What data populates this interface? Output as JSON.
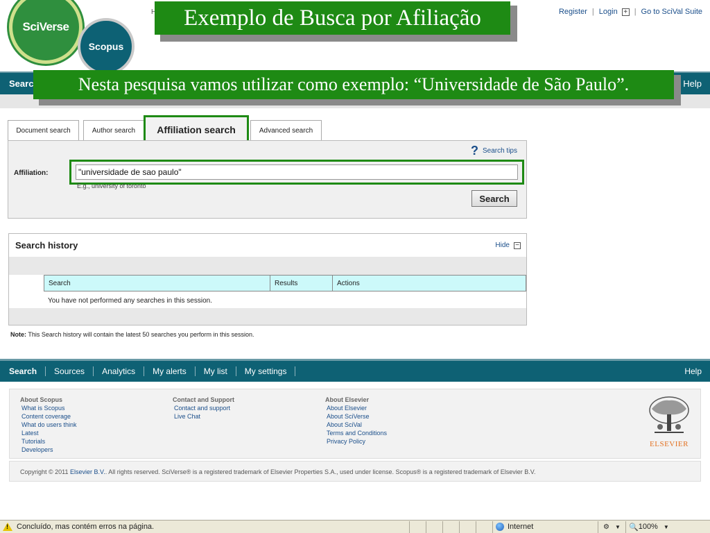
{
  "header": {
    "logo_sciverse": "SciVerse",
    "logo_scopus": "Scopus",
    "stray_char": "H",
    "links": {
      "register": "Register",
      "login": "Login",
      "scival": "Go to SciVal Suite"
    }
  },
  "callouts": {
    "title": "Exemplo de Busca por Afiliação",
    "subtitle": "Nesta pesquisa vamos utilizar como exemplo: “Universidade de São Paulo”."
  },
  "topnav": {
    "left_label": "Search",
    "right_label": "Help"
  },
  "tabs": [
    {
      "label": "Document search"
    },
    {
      "label": "Author search"
    },
    {
      "label": "Affiliation search",
      "active": true
    },
    {
      "label": "Advanced search"
    }
  ],
  "search_panel": {
    "tips_label": "Search tips",
    "affiliation_label": "Affiliation:",
    "affiliation_value": "\"universidade de sao paulo\"",
    "hint": "E.g., university of toronto",
    "search_button": "Search"
  },
  "history": {
    "title": "Search history",
    "hide_label": "Hide",
    "columns": [
      "Search",
      "Results",
      "Actions"
    ],
    "empty_message": "You have not performed any searches in this session.",
    "note_label": "Note:",
    "note_text": "This Search history will contain the latest 50 searches you perform in this session."
  },
  "bottomnav": {
    "items": [
      "Search",
      "Sources",
      "Analytics",
      "My alerts",
      "My list",
      "My settings"
    ],
    "help": "Help"
  },
  "footer": {
    "columns": [
      {
        "heading": "About Scopus",
        "links": [
          "What is Scopus",
          "Content coverage",
          "What do users think",
          "Latest",
          "Tutorials",
          "Developers"
        ]
      },
      {
        "heading": "Contact and Support",
        "links": [
          "Contact and support",
          "Live Chat"
        ]
      },
      {
        "heading": "About Elsevier",
        "links": [
          "About Elsevier",
          "About SciVerse",
          "About SciVal",
          "Terms and Conditions",
          "Privacy Policy"
        ]
      }
    ],
    "elsevier_logo": "ELSEVIER",
    "copyright_prefix": "Copyright © 2011",
    "copyright_link": "Elsevier B.V.",
    "copyright_suffix": "All rights reserved. SciVerse® is a registered trademark of Elsevier Properties S.A., used under license. Scopus® is a registered trademark of Elsevier B.V."
  },
  "statusbar": {
    "message": "Concluído, mas contém erros na página.",
    "zone": "Internet",
    "zoom": "100%"
  },
  "colors": {
    "nav_teal": "#0e6174",
    "callout_green": "#1e8a14",
    "link_blue": "#1a4e8a",
    "history_header": "#ccf9fa"
  }
}
